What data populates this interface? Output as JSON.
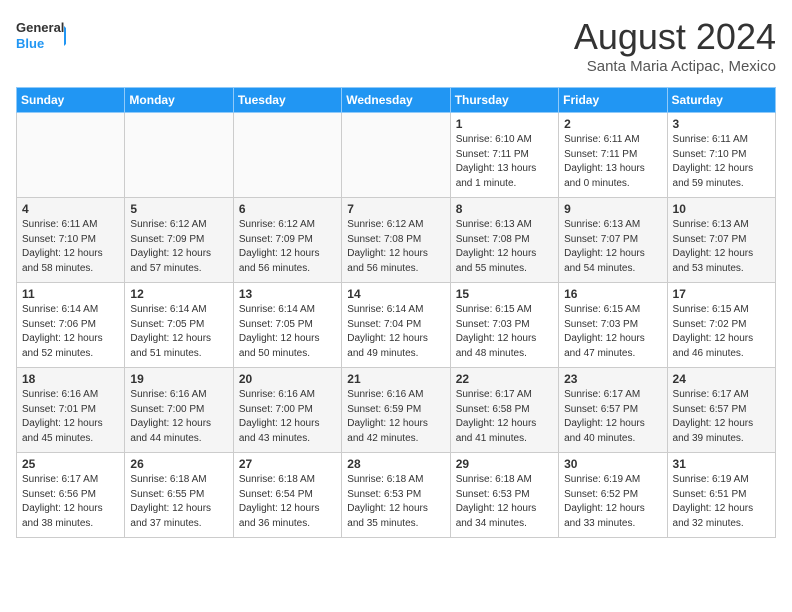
{
  "header": {
    "logo_general": "General",
    "logo_blue": "Blue",
    "month_title": "August 2024",
    "location": "Santa Maria Actipac, Mexico"
  },
  "days_of_week": [
    "Sunday",
    "Monday",
    "Tuesday",
    "Wednesday",
    "Thursday",
    "Friday",
    "Saturday"
  ],
  "weeks": [
    {
      "row_class": "week-odd",
      "days": [
        {
          "number": "",
          "info": "",
          "empty": true
        },
        {
          "number": "",
          "info": "",
          "empty": true
        },
        {
          "number": "",
          "info": "",
          "empty": true
        },
        {
          "number": "",
          "info": "",
          "empty": true
        },
        {
          "number": "1",
          "info": "Sunrise: 6:10 AM\nSunset: 7:11 PM\nDaylight: 13 hours\nand 1 minute."
        },
        {
          "number": "2",
          "info": "Sunrise: 6:11 AM\nSunset: 7:11 PM\nDaylight: 13 hours\nand 0 minutes."
        },
        {
          "number": "3",
          "info": "Sunrise: 6:11 AM\nSunset: 7:10 PM\nDaylight: 12 hours\nand 59 minutes."
        }
      ]
    },
    {
      "row_class": "week-even",
      "days": [
        {
          "number": "4",
          "info": "Sunrise: 6:11 AM\nSunset: 7:10 PM\nDaylight: 12 hours\nand 58 minutes."
        },
        {
          "number": "5",
          "info": "Sunrise: 6:12 AM\nSunset: 7:09 PM\nDaylight: 12 hours\nand 57 minutes."
        },
        {
          "number": "6",
          "info": "Sunrise: 6:12 AM\nSunset: 7:09 PM\nDaylight: 12 hours\nand 56 minutes."
        },
        {
          "number": "7",
          "info": "Sunrise: 6:12 AM\nSunset: 7:08 PM\nDaylight: 12 hours\nand 56 minutes."
        },
        {
          "number": "8",
          "info": "Sunrise: 6:13 AM\nSunset: 7:08 PM\nDaylight: 12 hours\nand 55 minutes."
        },
        {
          "number": "9",
          "info": "Sunrise: 6:13 AM\nSunset: 7:07 PM\nDaylight: 12 hours\nand 54 minutes."
        },
        {
          "number": "10",
          "info": "Sunrise: 6:13 AM\nSunset: 7:07 PM\nDaylight: 12 hours\nand 53 minutes."
        }
      ]
    },
    {
      "row_class": "week-odd",
      "days": [
        {
          "number": "11",
          "info": "Sunrise: 6:14 AM\nSunset: 7:06 PM\nDaylight: 12 hours\nand 52 minutes."
        },
        {
          "number": "12",
          "info": "Sunrise: 6:14 AM\nSunset: 7:05 PM\nDaylight: 12 hours\nand 51 minutes."
        },
        {
          "number": "13",
          "info": "Sunrise: 6:14 AM\nSunset: 7:05 PM\nDaylight: 12 hours\nand 50 minutes."
        },
        {
          "number": "14",
          "info": "Sunrise: 6:14 AM\nSunset: 7:04 PM\nDaylight: 12 hours\nand 49 minutes."
        },
        {
          "number": "15",
          "info": "Sunrise: 6:15 AM\nSunset: 7:03 PM\nDaylight: 12 hours\nand 48 minutes."
        },
        {
          "number": "16",
          "info": "Sunrise: 6:15 AM\nSunset: 7:03 PM\nDaylight: 12 hours\nand 47 minutes."
        },
        {
          "number": "17",
          "info": "Sunrise: 6:15 AM\nSunset: 7:02 PM\nDaylight: 12 hours\nand 46 minutes."
        }
      ]
    },
    {
      "row_class": "week-even",
      "days": [
        {
          "number": "18",
          "info": "Sunrise: 6:16 AM\nSunset: 7:01 PM\nDaylight: 12 hours\nand 45 minutes."
        },
        {
          "number": "19",
          "info": "Sunrise: 6:16 AM\nSunset: 7:00 PM\nDaylight: 12 hours\nand 44 minutes."
        },
        {
          "number": "20",
          "info": "Sunrise: 6:16 AM\nSunset: 7:00 PM\nDaylight: 12 hours\nand 43 minutes."
        },
        {
          "number": "21",
          "info": "Sunrise: 6:16 AM\nSunset: 6:59 PM\nDaylight: 12 hours\nand 42 minutes."
        },
        {
          "number": "22",
          "info": "Sunrise: 6:17 AM\nSunset: 6:58 PM\nDaylight: 12 hours\nand 41 minutes."
        },
        {
          "number": "23",
          "info": "Sunrise: 6:17 AM\nSunset: 6:57 PM\nDaylight: 12 hours\nand 40 minutes."
        },
        {
          "number": "24",
          "info": "Sunrise: 6:17 AM\nSunset: 6:57 PM\nDaylight: 12 hours\nand 39 minutes."
        }
      ]
    },
    {
      "row_class": "week-odd",
      "days": [
        {
          "number": "25",
          "info": "Sunrise: 6:17 AM\nSunset: 6:56 PM\nDaylight: 12 hours\nand 38 minutes."
        },
        {
          "number": "26",
          "info": "Sunrise: 6:18 AM\nSunset: 6:55 PM\nDaylight: 12 hours\nand 37 minutes."
        },
        {
          "number": "27",
          "info": "Sunrise: 6:18 AM\nSunset: 6:54 PM\nDaylight: 12 hours\nand 36 minutes."
        },
        {
          "number": "28",
          "info": "Sunrise: 6:18 AM\nSunset: 6:53 PM\nDaylight: 12 hours\nand 35 minutes."
        },
        {
          "number": "29",
          "info": "Sunrise: 6:18 AM\nSunset: 6:53 PM\nDaylight: 12 hours\nand 34 minutes."
        },
        {
          "number": "30",
          "info": "Sunrise: 6:19 AM\nSunset: 6:52 PM\nDaylight: 12 hours\nand 33 minutes."
        },
        {
          "number": "31",
          "info": "Sunrise: 6:19 AM\nSunset: 6:51 PM\nDaylight: 12 hours\nand 32 minutes."
        }
      ]
    }
  ]
}
